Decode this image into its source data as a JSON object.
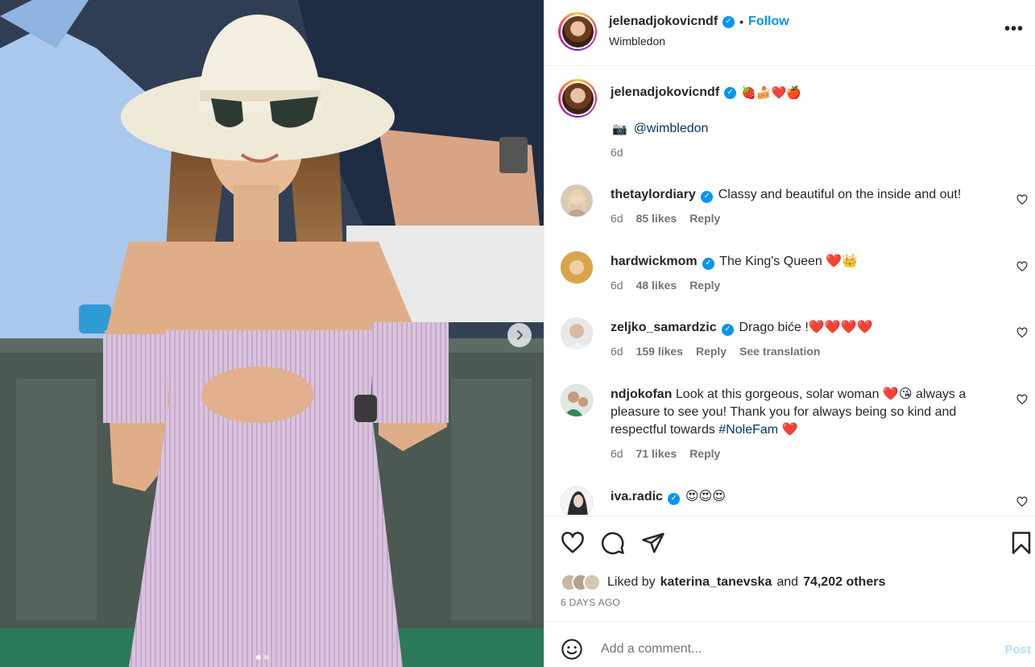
{
  "post": {
    "username": "jelenadjokovicndf",
    "verified": true,
    "follow_label": "Follow",
    "separator": "•",
    "location": "Wimbledon",
    "more_label": "•••"
  },
  "caption": {
    "username": "jelenadjokovicndf",
    "emojis": "🍓🍰❤️🍎",
    "camera_emoji": "📷",
    "mention": "@wimbledon",
    "time": "6d"
  },
  "comments": [
    {
      "username": "thetaylordiary",
      "text": "Classy and beautiful on the inside and out!",
      "time": "6d",
      "likes": "85 likes",
      "reply": "Reply",
      "avatar_color": "#d9c7b8"
    },
    {
      "username": "hardwickmom",
      "text": "The King's Queen ❤️👑",
      "time": "6d",
      "likes": "48 likes",
      "reply": "Reply",
      "avatar_color": "#c9943a"
    },
    {
      "username": "zeljko_samardzic",
      "text": "Drago biće !❤️❤️❤️❤️",
      "time": "6d",
      "likes": "159 likes",
      "reply": "Reply",
      "translate": "See translation",
      "avatar_color": "#cfcfcf"
    },
    {
      "username": "ndjokofan",
      "text_before": "Look at this gorgeous, solar woman ❤️😘 always a pleasure to see you! Thank you for always being so kind and respectful towards ",
      "hashtag": "#NoleFam",
      "text_after": " ❤️",
      "time": "6d",
      "likes": "71 likes",
      "reply": "Reply",
      "avatar_color": "#4d7a4a"
    },
    {
      "username": "iva.radic",
      "text": "😍😍😍",
      "avatar_color": "#3c3c3c"
    }
  ],
  "actions": {
    "like_icon": "heart-icon",
    "comment_icon": "comment-icon",
    "share_icon": "share-icon",
    "save_icon": "bookmark-icon"
  },
  "likes": {
    "prefix": "Liked by",
    "user": "katerina_tanevska",
    "joiner": "and",
    "others": "74,202 others"
  },
  "date": "6 DAYS AGO",
  "add_comment": {
    "placeholder": "Add a comment...",
    "post_label": "Post"
  },
  "colors": {
    "accent": "#0095f6",
    "post_disabled": "#b2dffc",
    "muted": "#737373",
    "heart_red": "#ed4956"
  }
}
